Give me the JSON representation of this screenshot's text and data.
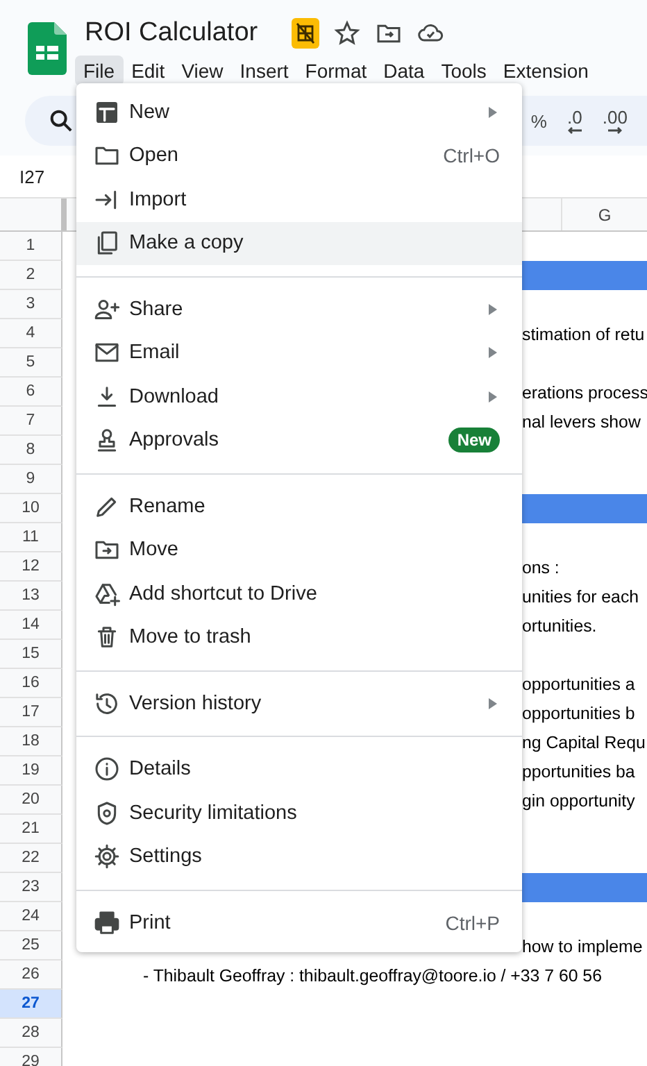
{
  "document": {
    "title": "ROI Calculator"
  },
  "menubar": [
    {
      "label": "File",
      "selected": true
    },
    {
      "label": "Edit",
      "selected": false
    },
    {
      "label": "View",
      "selected": false
    },
    {
      "label": "Insert",
      "selected": false
    },
    {
      "label": "Format",
      "selected": false
    },
    {
      "label": "Data",
      "selected": false
    },
    {
      "label": "Tools",
      "selected": false
    },
    {
      "label": "Extension",
      "selected": false
    }
  ],
  "toolbar": {
    "percent": "%",
    "decrease_decimals": ".0",
    "increase_decimals": ".00"
  },
  "name_box": "I27",
  "columns": [
    {
      "label": "G"
    }
  ],
  "rows": [
    {
      "number": "1",
      "selected": false,
      "band": false
    },
    {
      "number": "2",
      "selected": false,
      "band": true
    },
    {
      "number": "3",
      "selected": false,
      "band": false
    },
    {
      "number": "4",
      "selected": false,
      "band": false,
      "text": "stimation of retu"
    },
    {
      "number": "5",
      "selected": false,
      "band": false
    },
    {
      "number": "6",
      "selected": false,
      "band": false,
      "text": "erations process"
    },
    {
      "number": "7",
      "selected": false,
      "band": false,
      "text": "nal levers show"
    },
    {
      "number": "8",
      "selected": false,
      "band": false
    },
    {
      "number": "9",
      "selected": false,
      "band": false
    },
    {
      "number": "10",
      "selected": false,
      "band": true
    },
    {
      "number": "11",
      "selected": false,
      "band": false
    },
    {
      "number": "12",
      "selected": false,
      "band": false,
      "text": "ons :"
    },
    {
      "number": "13",
      "selected": false,
      "band": false,
      "text": "unities for each"
    },
    {
      "number": "14",
      "selected": false,
      "band": false,
      "text": "ortunities."
    },
    {
      "number": "15",
      "selected": false,
      "band": false
    },
    {
      "number": "16",
      "selected": false,
      "band": false,
      "text": "opportunities a"
    },
    {
      "number": "17",
      "selected": false,
      "band": false,
      "text": "opportunities b"
    },
    {
      "number": "18",
      "selected": false,
      "band": false,
      "text": "ng Capital Requ"
    },
    {
      "number": "19",
      "selected": false,
      "band": false,
      "text": "pportunities ba"
    },
    {
      "number": "20",
      "selected": false,
      "band": false,
      "text": "gin opportunity"
    },
    {
      "number": "21",
      "selected": false,
      "band": false
    },
    {
      "number": "22",
      "selected": false,
      "band": false
    },
    {
      "number": "23",
      "selected": false,
      "band": true
    },
    {
      "number": "24",
      "selected": false,
      "band": false
    },
    {
      "number": "25",
      "selected": false,
      "band": false,
      "text": "how to impleme"
    },
    {
      "number": "26",
      "selected": false,
      "band": false,
      "kind": "list_item",
      "text": "- Thibault Geoffray : thibault.geoffray@toore.io / +33 7 60 56"
    },
    {
      "number": "27",
      "selected": true,
      "band": false
    },
    {
      "number": "28",
      "selected": false,
      "band": false
    },
    {
      "number": "29",
      "selected": false,
      "band": false
    }
  ],
  "file_menu": {
    "groups": [
      [
        {
          "label": "New",
          "submenu": true,
          "selected": false
        },
        {
          "label": "Open",
          "shortcut": "Ctrl+O",
          "submenu": false,
          "selected": false
        },
        {
          "label": "Import",
          "submenu": false,
          "selected": false
        },
        {
          "label": "Make a copy",
          "submenu": false,
          "selected": true
        }
      ],
      [
        {
          "label": "Share",
          "submenu": true,
          "selected": false
        },
        {
          "label": "Email",
          "submenu": true,
          "selected": false
        },
        {
          "label": "Download",
          "submenu": true,
          "selected": false
        },
        {
          "label": "Approvals",
          "badge": "New",
          "submenu": false,
          "selected": false
        }
      ],
      [
        {
          "label": "Rename",
          "submenu": false,
          "selected": false
        },
        {
          "label": "Move",
          "submenu": false,
          "selected": false
        },
        {
          "label": "Add shortcut to Drive",
          "submenu": false,
          "selected": false
        },
        {
          "label": "Move to trash",
          "submenu": false,
          "selected": false
        }
      ],
      [
        {
          "label": "Version history",
          "submenu": true,
          "selected": false
        }
      ],
      [
        {
          "label": "Details",
          "submenu": false,
          "selected": false
        },
        {
          "label": "Security limitations",
          "submenu": false,
          "selected": false
        },
        {
          "label": "Settings",
          "submenu": false,
          "selected": false
        }
      ],
      [
        {
          "label": "Print",
          "shortcut": "Ctrl+P",
          "submenu": false,
          "selected": false
        }
      ]
    ]
  }
}
